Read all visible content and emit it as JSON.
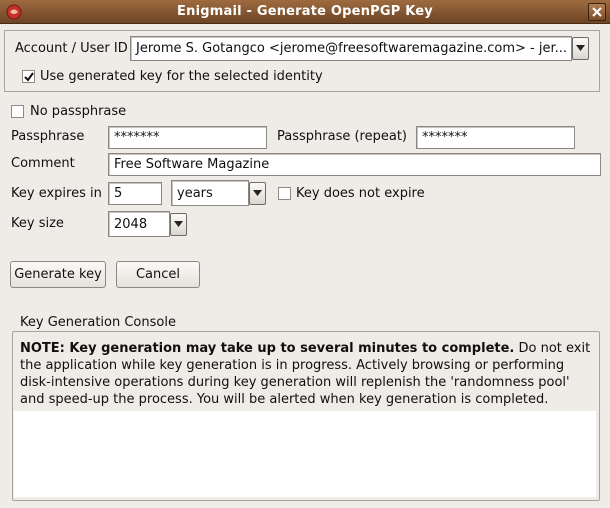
{
  "window": {
    "title": "Enigmail - Generate OpenPGP Key",
    "app_icon": "enigmail-icon",
    "close_icon": "close-icon"
  },
  "identity": {
    "label": "Account / User ID",
    "value": "Jerome S. Gotangco <jerome@freesoftwaremagazine.com> - jer...",
    "use_generated_key_label": "Use generated key for the selected identity",
    "use_generated_key_checked": true
  },
  "passphrase": {
    "no_passphrase_label": "No passphrase",
    "no_passphrase_checked": false,
    "passphrase_label": "Passphrase",
    "passphrase_value": "*******",
    "repeat_label": "Passphrase (repeat)",
    "repeat_value": "*******"
  },
  "comment": {
    "label": "Comment",
    "value": "Free Software Magazine"
  },
  "expiry": {
    "label": "Key expires in",
    "amount": "5",
    "unit": "years",
    "no_expire_label": "Key does not expire",
    "no_expire_checked": false
  },
  "keysize": {
    "label": "Key size",
    "value": "2048"
  },
  "buttons": {
    "generate": "Generate key",
    "cancel": "Cancel"
  },
  "console": {
    "legend": "Key Generation Console",
    "note_bold": "NOTE: Key generation may take up to several minutes to complete.",
    "note_rest": " Do not exit the application while key generation is in progress. Actively browsing or performing disk-intensive operations during key generation will replenish the 'randomness pool' and speed-up the process. You will be alerted when key generation is completed."
  },
  "colors": {
    "titlebar": "#8a5a33",
    "window_bg": "#efebe7"
  }
}
